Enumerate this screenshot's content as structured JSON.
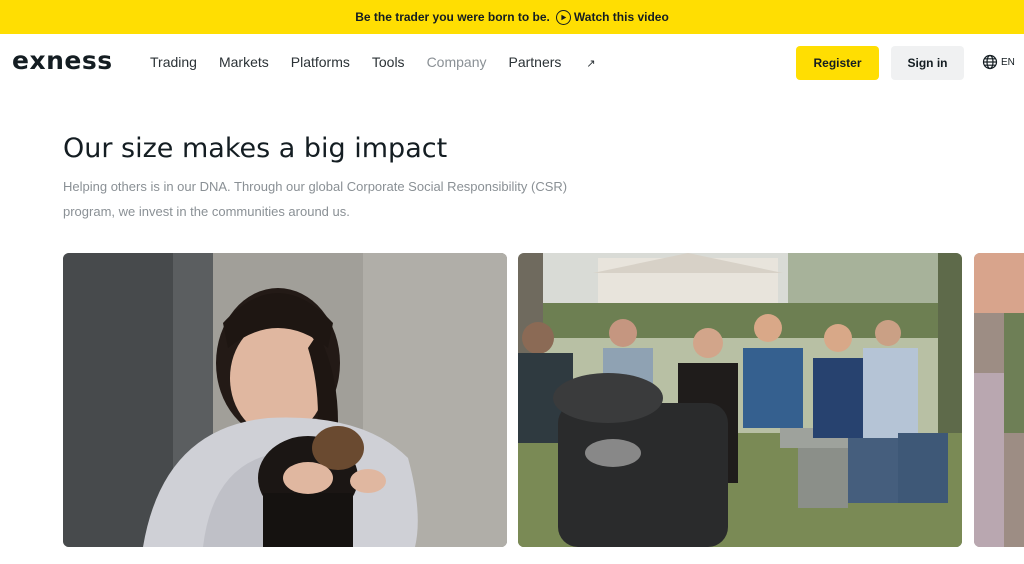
{
  "banner": {
    "text": "Be the trader you were born to be.",
    "link": "Watch this video"
  },
  "nav": {
    "logo": "exness",
    "items": [
      {
        "label": "Trading"
      },
      {
        "label": "Markets"
      },
      {
        "label": "Platforms"
      },
      {
        "label": "Tools"
      },
      {
        "label": "Company"
      },
      {
        "label": "Partners"
      }
    ],
    "register": "Register",
    "signin": "Sign in",
    "language": "EN"
  },
  "hero": {
    "title": "Our size makes a big impact",
    "subtitle": "Helping others is in our DNA. Through our global Corporate Social Responsibility (CSR) program, we invest in the communities around us."
  },
  "colors": {
    "brand_yellow": "#ffde02",
    "text_dark": "#141d22",
    "text_muted": "#8a9095"
  },
  "icons": {
    "play": "play-circle-icon",
    "globe": "globe-icon",
    "external": "arrow-up-right-icon"
  }
}
